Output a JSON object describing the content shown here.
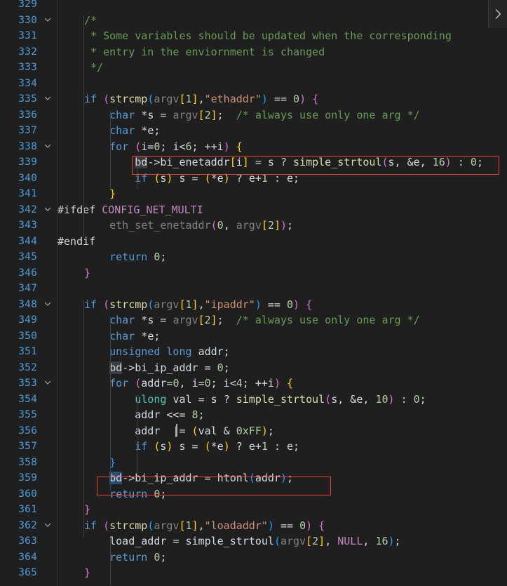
{
  "editor": {
    "theme": "dark-plus",
    "background": "#1f1f1f",
    "line_height_px": 22.5,
    "first_visible_line": 329,
    "last_visible_line": 365,
    "language": "c",
    "accent_selection": "#264f78",
    "annotation_color": "#e8453c"
  },
  "widget": {
    "name": "chevron-right-icon",
    "tooltip": "Show next"
  },
  "line_numbers": [
    "329",
    "330",
    "331",
    "332",
    "333",
    "334",
    "335",
    "336",
    "337",
    "338",
    "339",
    "340",
    "341",
    "342",
    "343",
    "344",
    "345",
    "346",
    "347",
    "348",
    "349",
    "350",
    "351",
    "352",
    "353",
    "354",
    "355",
    "356",
    "357",
    "358",
    "359",
    "360",
    "361",
    "362",
    "363",
    "364",
    "365"
  ],
  "fold_lines": [
    "330",
    "335",
    "338",
    "342",
    "348",
    "353",
    "362"
  ],
  "lines": {
    "l329": "",
    "l330": "    /*",
    "l331": "     * Some variables should be updated when the corresponding",
    "l332": "     * entry in the enviornment is changed",
    "l333": "     */",
    "l334": "",
    "l335": "    if (strcmp(argv[1],\"ethaddr\") == 0) {",
    "l336": "        char *s = argv[2];  /* always use only one arg */",
    "l337": "        char *e;",
    "l338": "        for (i=0; i<6; ++i) {",
    "l339": "            bd->bi_enetaddr[i] = s ? simple_strtoul(s, &e, 16) : 0;",
    "l340": "            if (s) s = (*e) ? e+1 : e;",
    "l341": "        }",
    "l342": "#ifdef CONFIG_NET_MULTI",
    "l343": "        eth_set_enetaddr(0, argv[2]);",
    "l344": "#endif",
    "l345": "        return 0;",
    "l346": "    }",
    "l347": "",
    "l348": "    if (strcmp(argv[1],\"ipaddr\") == 0) {",
    "l349": "        char *s = argv[2];  /* always use only one arg */",
    "l350": "        char *e;",
    "l351": "        unsigned long addr;",
    "l352": "        bd->bi_ip_addr = 0;",
    "l353": "        for (addr=0, i=0; i<4; ++i) {",
    "l354": "            ulong val = s ? simple_strtoul(s, &e, 10) : 0;",
    "l355": "            addr <<= 8;",
    "l356": "            addr  |= (val & 0xFF);",
    "l357": "            if (s) s = (*e) ? e+1 : e;",
    "l358": "        }",
    "l359": "        bd->bi_ip_addr = htonl(addr);",
    "l360": "        return 0;",
    "l361": "    }",
    "l362": "    if (strcmp(argv[1],\"loadaddr\") == 0) {",
    "l363": "        load_addr = simple_strtoul(argv[2], NULL, 16);",
    "l364": "        return 0;",
    "l365": "    }"
  },
  "annotations": [
    {
      "name": "highlight-box-enetaddr",
      "target_line": "339",
      "text": "bd->bi_enetaddr[i] = s ? simple_strtoul(s, &e, 16) : 0;"
    },
    {
      "name": "highlight-box-ip-addr",
      "target_line": "359",
      "text": "bd->bi_ip_addr = htonl(addr);"
    }
  ],
  "selection": {
    "word": "bd",
    "active_line": "359",
    "occurrence_lines": [
      "339",
      "352"
    ]
  }
}
